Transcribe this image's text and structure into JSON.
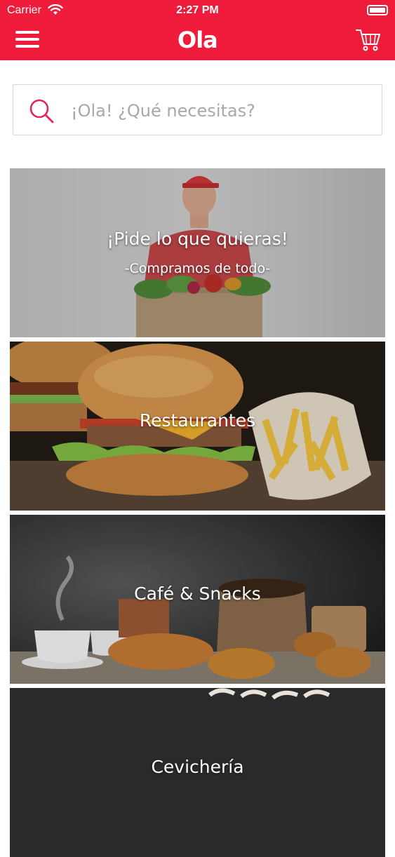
{
  "status_bar": {
    "carrier": "Carrier",
    "time": "2:27 PM"
  },
  "header": {
    "logo": "Ola",
    "menu_icon": "hamburger-icon",
    "cart_icon": "shopping-cart-icon"
  },
  "search": {
    "placeholder": "¡Ola! ¿Qué necesitas?",
    "value": "",
    "icon": "search-icon"
  },
  "categories": [
    {
      "title": "¡Pide lo que quieras!",
      "subtitle": "-Compramos de todo-"
    },
    {
      "title": "Restaurantes"
    },
    {
      "title": "Café & Snacks"
    },
    {
      "title": "Cevichería"
    }
  ],
  "colors": {
    "brand": "#ee1c3a",
    "search_icon": "#e0245e",
    "border": "#d7d7d7"
  }
}
